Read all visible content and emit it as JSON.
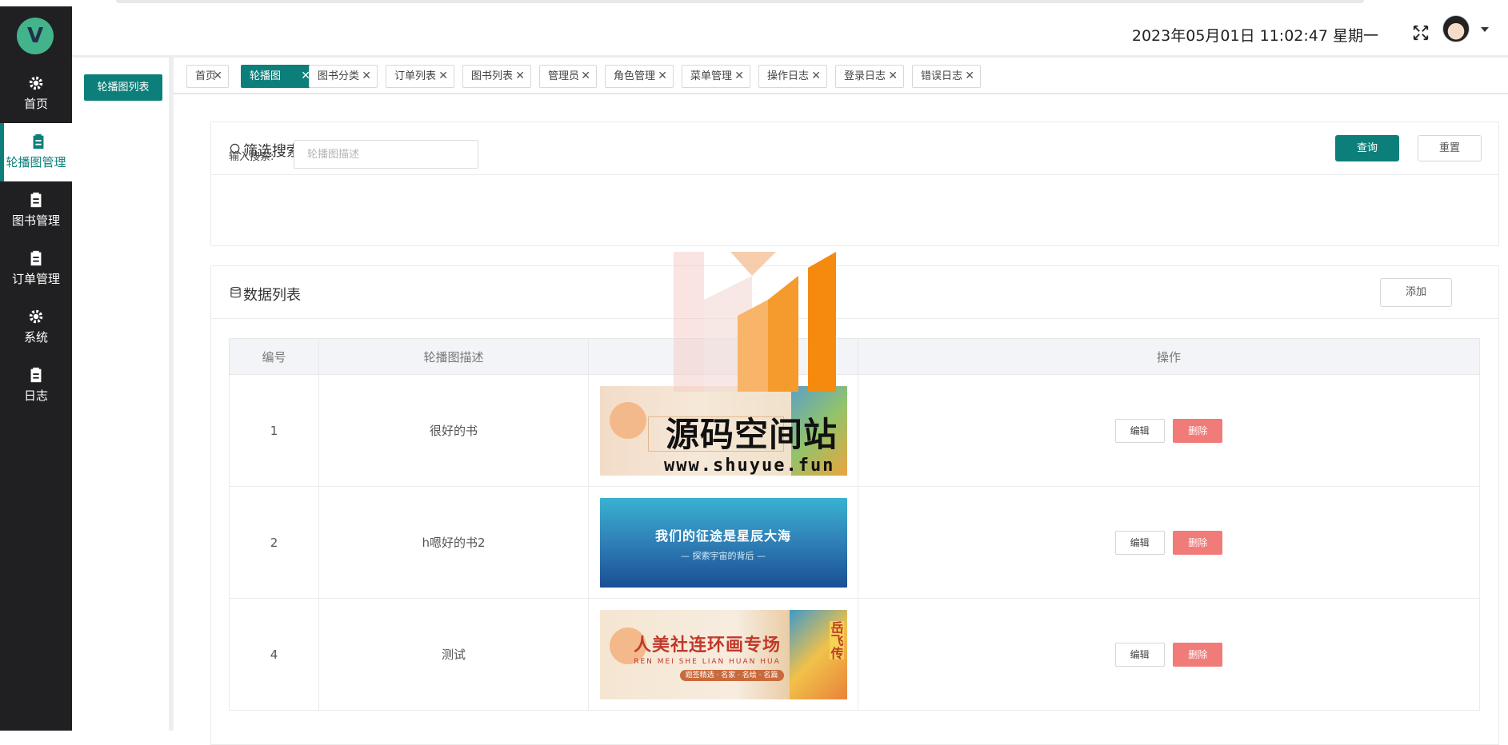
{
  "sidebar": {
    "logo_letter": "V",
    "items": [
      {
        "label": "首页",
        "icon": "gear-icon"
      },
      {
        "label": "轮播图管理",
        "icon": "clipboard-icon"
      },
      {
        "label": "图书管理",
        "icon": "clipboard-icon"
      },
      {
        "label": "订单管理",
        "icon": "clipboard-icon"
      },
      {
        "label": "系统",
        "icon": "gear-icon"
      },
      {
        "label": "日志",
        "icon": "clipboard-icon"
      }
    ]
  },
  "subnav": {
    "active_label": "轮播图列表"
  },
  "header": {
    "datetime": "2023年05月01日 11:02:47 星期一"
  },
  "tabs": [
    {
      "label": "首页"
    },
    {
      "label": "轮播图"
    },
    {
      "label": "图书分类"
    },
    {
      "label": "订单列表"
    },
    {
      "label": "图书列表"
    },
    {
      "label": "管理员"
    },
    {
      "label": "角色管理"
    },
    {
      "label": "菜单管理"
    },
    {
      "label": "操作日志"
    },
    {
      "label": "登录日志"
    },
    {
      "label": "错误日志"
    }
  ],
  "filter": {
    "title": "筛选搜索",
    "query_label": "查询",
    "reset_label": "重置",
    "input_label": "输入搜索:",
    "input_placeholder": "轮播图描述"
  },
  "list": {
    "title": "数据列表",
    "add_label": "添加",
    "columns": [
      "编号",
      "轮播图描述",
      "",
      "操作"
    ],
    "rows": [
      {
        "id": "1",
        "desc": "很好的书"
      },
      {
        "id": "2",
        "desc": "h嗯好的书2"
      },
      {
        "id": "4",
        "desc": "测试"
      }
    ],
    "edit_label": "编辑",
    "delete_label": "删除"
  },
  "images": {
    "banner2_title": "我们的征途是星辰大海",
    "banner2_sub": "— 探索宇宙的背后 —",
    "banner3_title": "人美社连环画专场",
    "banner3_sub": "REN MEI SHE LIAN HUAN HUA",
    "banner3_band": "题签精选 · 名家 · 名绘 · 名篇",
    "banner3_side": "岳飞传"
  },
  "watermark": {
    "text": "源码空间站",
    "url": "www.shuyue.fun"
  },
  "colors": {
    "accent": "#0d7f7a",
    "sidebar": "#202022",
    "danger": "#f07b78"
  }
}
